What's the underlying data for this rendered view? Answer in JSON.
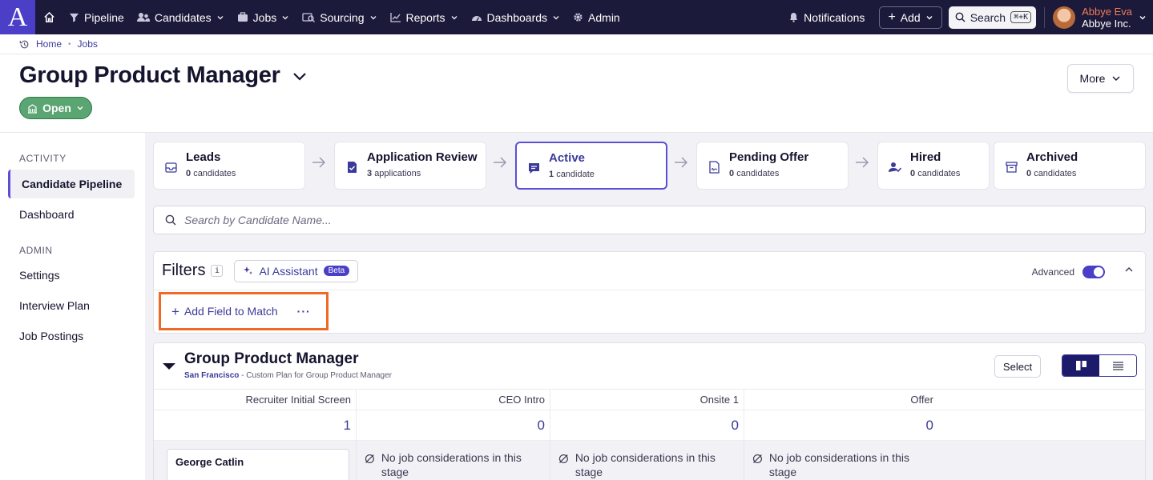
{
  "nav": {
    "logo": "A",
    "items": [
      {
        "label": "Pipeline",
        "icon": "filter-icon"
      },
      {
        "label": "Candidates",
        "icon": "people-icon"
      },
      {
        "label": "Jobs",
        "icon": "briefcase-icon"
      },
      {
        "label": "Sourcing",
        "icon": "sourcing-icon"
      },
      {
        "label": "Reports",
        "icon": "chart-icon"
      },
      {
        "label": "Dashboards",
        "icon": "gauge-icon"
      },
      {
        "label": "Admin",
        "icon": "gear-icon"
      }
    ],
    "notifications": "Notifications",
    "add": "Add",
    "search": "Search",
    "shortcut": "⌘+K",
    "user_name": "Abbye Eva",
    "user_org": "Abbye Inc."
  },
  "breadcrumb": [
    "Home",
    "Jobs"
  ],
  "header": {
    "title": "Group Product Manager",
    "status": "Open",
    "more": "More"
  },
  "sidebar": {
    "sections": [
      {
        "title": "ACTIVITY",
        "items": [
          "Candidate Pipeline",
          "Dashboard"
        ]
      },
      {
        "title": "ADMIN",
        "items": [
          "Settings",
          "Interview Plan",
          "Job Postings"
        ]
      }
    ],
    "active_item": "Candidate Pipeline"
  },
  "stages": [
    {
      "name": "Leads",
      "count": "0",
      "unit": "candidates"
    },
    {
      "name": "Application Review",
      "count": "3",
      "unit": "applications"
    },
    {
      "name": "Active",
      "count": "1",
      "unit": "candidate"
    },
    {
      "name": "Pending Offer",
      "count": "0",
      "unit": "candidates"
    },
    {
      "name": "Hired",
      "count": "0",
      "unit": "candidates"
    },
    {
      "name": "Archived",
      "count": "0",
      "unit": "candidates"
    }
  ],
  "search": {
    "placeholder": "Search by Candidate Name..."
  },
  "filters": {
    "title": "Filters",
    "info": "i",
    "ai_assistant": "AI Assistant",
    "beta": "Beta",
    "advanced": "Advanced",
    "add_field": "Add Field to Match",
    "more": "···"
  },
  "plan": {
    "title": "Group Product Manager",
    "location": "San Francisco",
    "subtitle": " - Custom Plan for Group Product Manager",
    "select": "Select",
    "columns": [
      "Recruiter Initial Screen",
      "CEO Intro",
      "Onsite 1",
      "Offer"
    ],
    "counts": [
      "1",
      "0",
      "0",
      "0"
    ],
    "candidate": "George Catlin",
    "empty_text": "No job considerations in this stage"
  },
  "colors": {
    "nav_bg": "#1c1a3a",
    "brand": "#4b3fc8",
    "status_green": "#5aa571",
    "highlight": "#ef6a24",
    "link": "#3b3a9a"
  }
}
